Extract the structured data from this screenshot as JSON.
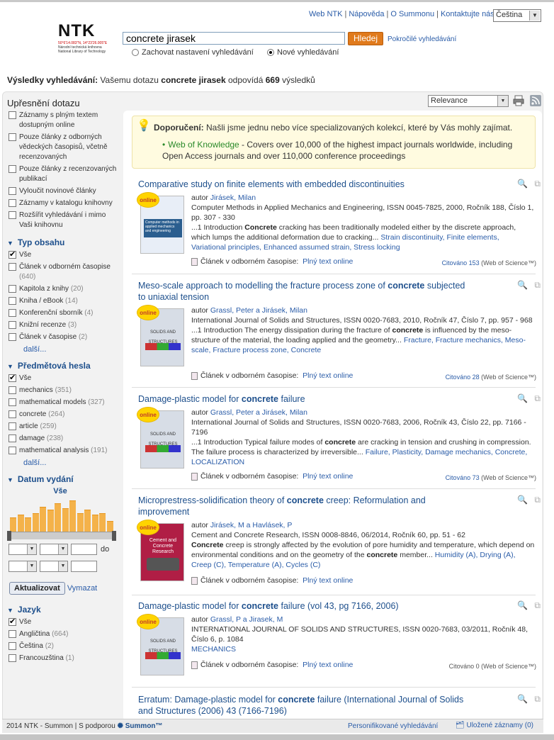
{
  "header": {
    "links": [
      "Web NTK",
      "Nápověda",
      "O Summonu",
      "Kontaktujte nás"
    ],
    "language": "Čeština",
    "logo_text": "NTK",
    "logo_sub1": "50°6'14.083\"N, 14°23'26.005\"E",
    "logo_sub2": "Národní technická knihovna",
    "logo_sub3": "National Library of Technology"
  },
  "search": {
    "query": "concrete jirasek",
    "button": "Hledej",
    "advanced": "Pokročilé vyhledávání",
    "keep_settings": "Zachovat nastavení vyhledávání",
    "new_search": "Nové vyhledávání"
  },
  "results_summary": {
    "label": "Výsledky vyhledávání:",
    "text1": "Vašemu dotazu",
    "query": "concrete jirasek",
    "text2": "odpovídá",
    "count": "669",
    "text3": "výsledků"
  },
  "sidebar": {
    "refine_title": "Upřesnění dotazu",
    "refine_options": [
      "Záznamy s plným textem dostupným online",
      "Pouze články z odborných vědeckých časopisů, včetně recenzovaných",
      "Pouze články z recenzovaných publikací",
      "Vyloučit novinové články",
      "Záznamy v katalogu knihovny",
      "Rozšířit vyhledávání i mimo Vaši knihovnu"
    ],
    "content_type_title": "Typ obsahu",
    "content_types": [
      {
        "label": "Vše",
        "count": ""
      },
      {
        "label": "Článek v odborném časopise",
        "count": "(640)"
      },
      {
        "label": "Kapitola z knihy",
        "count": "(20)"
      },
      {
        "label": "Kniha / eBook",
        "count": "(14)"
      },
      {
        "label": "Konferenční sborník",
        "count": "(4)"
      },
      {
        "label": "Knižní recenze",
        "count": "(3)"
      },
      {
        "label": "Článek v časopise",
        "count": "(2)"
      }
    ],
    "more": "další...",
    "subjects_title": "Předmětová hesla",
    "subjects": [
      {
        "label": "Vše",
        "count": ""
      },
      {
        "label": "mechanics",
        "count": "(351)"
      },
      {
        "label": "mathematical models",
        "count": "(327)"
      },
      {
        "label": "concrete",
        "count": "(264)"
      },
      {
        "label": "article",
        "count": "(259)"
      },
      {
        "label": "damage",
        "count": "(238)"
      },
      {
        "label": "mathematical analysis",
        "count": "(191)"
      }
    ],
    "date_title": "Datum vydání",
    "date_all": "Vše",
    "date_to": "do",
    "update_button": "Aktualizovat",
    "clear_link": "Vymazat",
    "language_title": "Jazyk",
    "languages": [
      {
        "label": "Vše",
        "count": ""
      },
      {
        "label": "Angličtina",
        "count": "(664)"
      },
      {
        "label": "Čeština",
        "count": "(2)"
      },
      {
        "label": "Francouzština",
        "count": "(1)"
      }
    ]
  },
  "sort": {
    "value": "Relevance"
  },
  "recommendation": {
    "label": "Doporučení:",
    "text": "Našli jsme jednu nebo více specializovaných kolekcí, které by Vás mohly zajímat.",
    "link": "Web of Knowledge",
    "desc": " - Covers over 10,000 of the highest impact journals worldwide, including Open Access journals and over 110,000 conference proceedings"
  },
  "results": [
    {
      "title": "Comparative study on finite elements with embedded discontinuities",
      "badge": "online",
      "author_prefix": "autor",
      "authors": "Jirásek, Milan",
      "source": "Computer Methods in Applied Mechanics and Engineering, ISSN 0045-7825, 2000, Ročník 188, Číslo 1, pp. 307 - 330",
      "snippet": "...1 Introduction Concrete cracking has been traditionally modeled either by the discrete approach, which lumps the additional deformation due to cracking...",
      "subjects": "Strain discontinuity, Finite elements, Variational principles, Enhanced assumed strain, Stress locking",
      "type": "Článek v odborném časopise:",
      "fulltext": "Plný text online",
      "cited": "Citováno 153",
      "cited_src": "(Web of Science™)"
    },
    {
      "title": "Meso-scale approach to modelling the fracture process zone of concrete subjected to uniaxial tension",
      "badge": "online",
      "author_prefix": "autor",
      "authors": "Grassl, Peter a Jirásek, Milan",
      "source": "International Journal of Solids and Structures, ISSN 0020-7683, 2010, Ročník 47, Číslo 7, pp. 957 - 968",
      "snippet": "...1 Introduction The energy dissipation during the fracture of concrete is influenced by the meso-structure of the material, the loading applied and the geometry...",
      "subjects": "Fracture, Fracture mechanics, Meso-scale, Fracture process zone, Concrete",
      "type": "Článek v odborném časopise:",
      "fulltext": "Plný text online",
      "cited": "Citováno 28",
      "cited_src": "(Web of Science™)"
    },
    {
      "title": "Damage-plastic model for concrete failure",
      "badge": "online",
      "author_prefix": "autor",
      "authors": "Grassl, Peter a Jirásek, Milan",
      "source": "International Journal of Solids and Structures, ISSN 0020-7683, 2006, Ročník 43, Číslo 22, pp. 7166 - 7196",
      "snippet": "...1 Introduction Typical failure modes of concrete are cracking in tension and crushing in compression. The failure process is characterized by irreversible...",
      "subjects": "Failure, Plasticity, Damage mechanics, Concrete, LOCALIZATION",
      "type": "Článek v odborném časopise:",
      "fulltext": "Plný text online",
      "cited": "Citováno 73",
      "cited_src": "(Web of Science™)"
    },
    {
      "title": "Microprestress-solidification theory of concrete creep: Reformulation and improvement",
      "badge": "online",
      "author_prefix": "autor",
      "authors": "Jirásek, M a Havlásek, P",
      "source": "Cement and Concrete Research, ISSN 0008-8846, 06/2014, Ročník 60, pp. 51 - 62",
      "snippet": "Concrete creep is strongly affected by the evolution of pore humidity and temperature, which depend on environmental conditions and on the geometry of the concrete member...",
      "subjects": "Humidity (A), Drying (A), Creep (C), Temperature (A), Cycles (C)",
      "type": "Článek v odborném časopise:",
      "fulltext": "Plný text online",
      "cited": "",
      "cited_src": ""
    },
    {
      "title": "Damage-plastic model for concrete failure (vol 43, pg 7166, 2006)",
      "badge": "online",
      "author_prefix": "autor",
      "authors": "Grassl, P a Jirasek, M",
      "source": "INTERNATIONAL JOURNAL OF SOLIDS AND STRUCTURES, ISSN 0020-7683, 03/2011, Ročník 48, Číslo 6, p. 1084",
      "snippet": "",
      "subjects": "MECHANICS",
      "type": "Článek v odborném časopise:",
      "fulltext": "Plný text online",
      "cited": "Citováno 0",
      "cited_src": "(Web of Science™)"
    },
    {
      "title": "Erratum: Damage-plastic model for concrete failure (International Journal of Solids and Structures (2006) 43 (7166-7196)"
    }
  ],
  "thumbs": {
    "t1_title": "Computer methods in applied mechanics and engineering",
    "t2_title": "SOLIDS AND STRUCTURES",
    "t4_title": "Cement and Concrete Research"
  },
  "footer": {
    "left": "2014 NTK - Summon",
    "powered": "S podporou",
    "summon": "Summon™",
    "personal": "Personifikované vyhledávání",
    "saved": "Uložené záznamy (0)"
  },
  "histogram": [
    0.45,
    0.55,
    0.45,
    0.6,
    0.8,
    0.7,
    0.9,
    0.75,
    1.0,
    0.6,
    0.7,
    0.55,
    0.6,
    0.35
  ]
}
